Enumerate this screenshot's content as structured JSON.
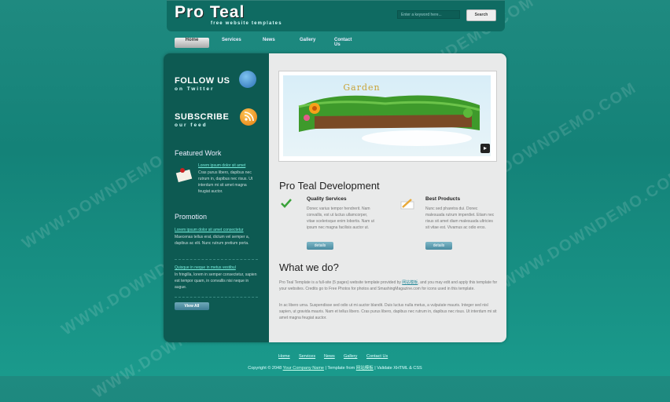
{
  "header": {
    "logo": "Pro Teal",
    "tagline": "free website templates",
    "search_placeholder": "Enter a keyword here...",
    "search_button": "Search"
  },
  "nav": {
    "items": [
      "Home",
      "Services",
      "News",
      "Gallery",
      "Contact Us"
    ],
    "active": "Home"
  },
  "sidebar": {
    "follow_title": "FOLLOW US",
    "follow_sub": "on Twitter",
    "subscribe_title": "SUBSCRIBE",
    "subscribe_sub": "our feed",
    "featured_heading": "Featured Work",
    "featured_link": "Lorem ipsum dolor sit amet",
    "featured_text": "Cras purus libero, dapibus nec rutrum in, dapibus nec risus. Ut interdum mi sit amet magna feugiat auctor.",
    "promo_heading": "Promotion",
    "promo1_link": "Lorem ipsum dolor sit amet consectetur",
    "promo1_text": "Maecenas tellus erat, dictum vel semper a, dapibus ac elit. Nunc rutrum pretium porta.",
    "promo2_link": "Quisque in neque in metus vestibul",
    "promo2_text": "In fringilla, lorem in semper consectetur, sapien est tempor quam, in convallis nisi neque in augue.",
    "view_all": "View All"
  },
  "slider": {
    "title": "Garden"
  },
  "main": {
    "heading": "Pro Teal Development",
    "col1_title": "Quality Services",
    "col1_text": "Donec varius tempor hendrerit. Nam convallis, est ut luctus ullamcorper, vitae scelerisque enim lobortis. Nam ut ipsum nec magna facilisis auctor ut.",
    "col2_title": "Best Products",
    "col2_text": "Nunc sed pharetra dui. Donec malesuada rutrum imperdiet. Etiam nec risus sit amet diam malesuada ultricies sit vitae est. Vivamus ac odio eros.",
    "details": "details",
    "what_heading": "What we do?",
    "para1_pre": "Pro Teal Template is a full-site (5 pages) website template provided by ",
    "para1_link": "网站模板",
    "para1_post": ", and you may edit and apply this template for your websites. Credits go to Free Photos for photos and SmashingMagazine.com for icons used in this template.",
    "para2": "In ac libero urna. Suspendisse sed odio ut mi auctor blandit. Duis luctus nulla metus, a vulputate mauris. Integer sed nisl sapien, ut gravida mauris. Nam et tellus libero. Cras purus libero, dapibus nec rutrum in, dapibus nec risus. Ut interdum mi sit amet magna feugiat auctor."
  },
  "footer": {
    "nav": [
      "Home",
      "Services",
      "News",
      "Gallery",
      "Contact Us"
    ],
    "copy_pre": "Copyright © 2048 ",
    "company": "Your Company Name",
    "copy_mid": " | Template from ",
    "template_link": "网站模板",
    "copy_post": " | Validate XHTML & CSS"
  },
  "watermark": "WWW.DOWNDEMO.COM"
}
